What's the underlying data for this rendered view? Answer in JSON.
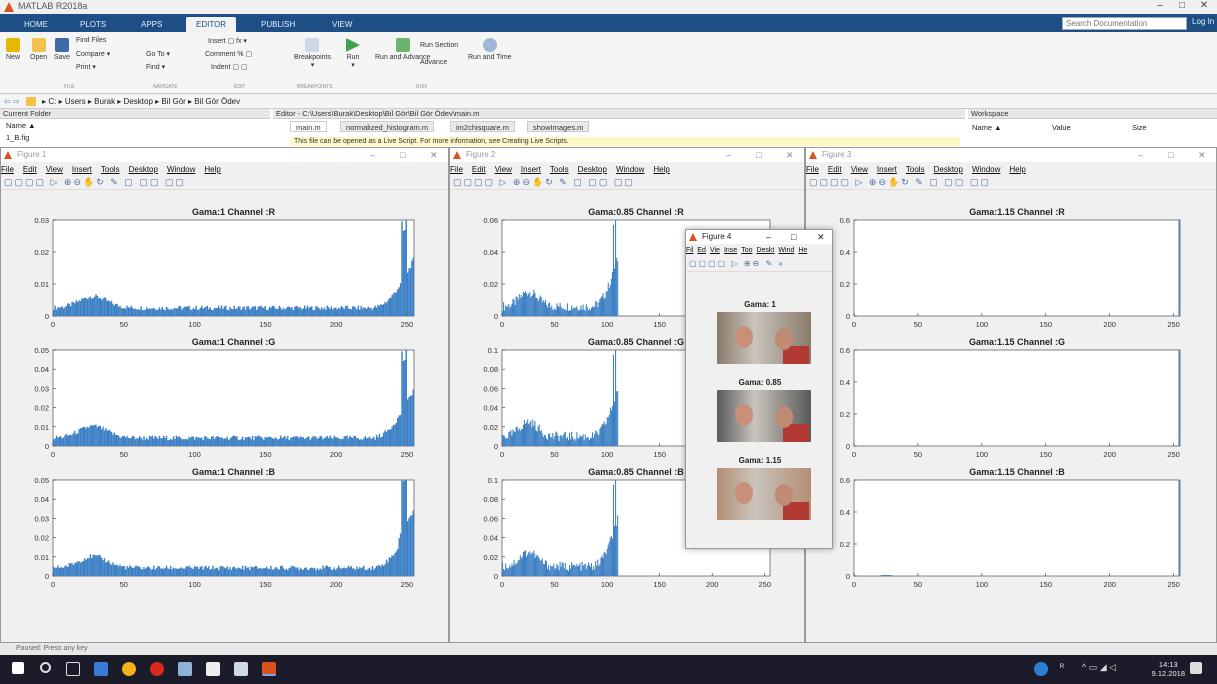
{
  "app": {
    "title": "MATLAB R2018a"
  },
  "tabs": [
    "HOME",
    "PLOTS",
    "APPS",
    "EDITOR",
    "PUBLISH",
    "VIEW"
  ],
  "search_placeholder": "Search Documentation",
  "login": "Log In",
  "toolstrip": {
    "new": "New",
    "open": "Open",
    "save": "Save",
    "find_files": "Find Files",
    "compare": "Compare",
    "print": "Print",
    "go_to": "Go To",
    "find": "Find",
    "insert": "Insert",
    "comment": "Comment",
    "indent": "Indent",
    "breakpoints": "Breakpoints",
    "run": "Run",
    "run_and_advance": "Run and Advance",
    "run_section": "Run Section",
    "advance": "Advance",
    "run_and_time": "Run and Time",
    "groups": [
      "FILE",
      "NAVIGATE",
      "EDIT",
      "BREAKPOINTS",
      "RUN"
    ]
  },
  "address": [
    "C:",
    "Users",
    "Burak",
    "Desktop",
    "Bil Gör",
    "Bil Gör Ödev"
  ],
  "current_folder": {
    "title": "Current Folder",
    "col": "Name ▲",
    "file": "1_B.fig"
  },
  "editor": {
    "title": "Editor - C:\\Users\\Burak\\Desktop\\Bil Gör\\Bil Gör Ödev\\main.m",
    "tabs": [
      "main.m",
      "normalized_histogram.m",
      "im2chisquare.m",
      "showImages.m"
    ],
    "info": "This file can be opened as a Live Script. For more information, see Creating Live Scripts."
  },
  "workspace": {
    "title": "Workspace",
    "cols": [
      "Name ▲",
      "Value",
      "Size"
    ]
  },
  "status_text": "Paused: Press any key",
  "fig_menu": [
    "File",
    "Edit",
    "View",
    "Insert",
    "Tools",
    "Desktop",
    "Window",
    "Help"
  ],
  "figures": [
    {
      "title": "Figure 1",
      "plots": [
        {
          "title": "Gama:1 Channel :R",
          "yticks": [
            "0",
            "0.01",
            "0.02",
            "0.03"
          ],
          "peak": 0.03
        },
        {
          "title": "Gama:1 Channel :G",
          "yticks": [
            "0",
            "0.01",
            "0.02",
            "0.03",
            "0.04",
            "0.05"
          ],
          "peak": 0.05
        },
        {
          "title": "Gama:1 Channel :B",
          "yticks": [
            "0",
            "0.01",
            "0.02",
            "0.03",
            "0.04",
            "0.05"
          ],
          "peak": 0.05
        }
      ]
    },
    {
      "title": "Figure 2",
      "plots": [
        {
          "title": "Gama:0.85 Channel :R",
          "yticks": [
            "0",
            "0.02",
            "0.04",
            "0.06"
          ],
          "peak": 0.06
        },
        {
          "title": "Gama:0.85 Channel :G",
          "yticks": [
            "0",
            "0.02",
            "0.04",
            "0.06",
            "0.08",
            "0.1"
          ],
          "peak": 0.1
        },
        {
          "title": "Gama:0.85 Channel :B",
          "yticks": [
            "0",
            "0.02",
            "0.04",
            "0.06",
            "0.08",
            "0.1"
          ],
          "peak": 0.1
        }
      ]
    },
    {
      "title": "Figure 3",
      "plots": [
        {
          "title": "Gama:1.15 Channel :R",
          "yticks": [
            "0",
            "0.2",
            "0.4",
            "0.6"
          ],
          "peak": 0.6
        },
        {
          "title": "Gama:1.15 Channel :G",
          "yticks": [
            "0",
            "0.2",
            "0.4",
            "0.6"
          ],
          "peak": 0.6
        },
        {
          "title": "Gama:1.15 Channel :B",
          "yticks": [
            "0",
            "0.2",
            "0.4",
            "0.6"
          ],
          "peak": 0.6
        }
      ]
    }
  ],
  "xticks": [
    "0",
    "50",
    "100",
    "150",
    "200",
    "250"
  ],
  "figure4": {
    "title": "Figure 4",
    "menu": [
      "Fil",
      "Ed",
      "Vie",
      "Inse",
      "Too",
      "Deskt",
      "Wind",
      "He"
    ],
    "images": [
      "Gama: 1",
      "Gama: 0.85",
      "Gama: 1.15"
    ]
  },
  "taskbar": {
    "time": "14:13",
    "date": "9.12.2018"
  },
  "colors": {
    "bar": "#3b7fc4",
    "accent": "#1d4f86"
  },
  "chart_data": [
    {
      "type": "bar",
      "title": "Gama:1 Channel :R",
      "ylim": [
        0,
        0.03
      ],
      "xlim": [
        0,
        255
      ]
    },
    {
      "type": "bar",
      "title": "Gama:1 Channel :G",
      "ylim": [
        0,
        0.05
      ],
      "xlim": [
        0,
        255
      ]
    },
    {
      "type": "bar",
      "title": "Gama:1 Channel :B",
      "ylim": [
        0,
        0.05
      ],
      "xlim": [
        0,
        255
      ]
    },
    {
      "type": "bar",
      "title": "Gama:0.85 Channel :R",
      "ylim": [
        0,
        0.06
      ],
      "xlim": [
        0,
        255
      ]
    },
    {
      "type": "bar",
      "title": "Gama:0.85 Channel :G",
      "ylim": [
        0,
        0.1
      ],
      "xlim": [
        0,
        255
      ]
    },
    {
      "type": "bar",
      "title": "Gama:0.85 Channel :B",
      "ylim": [
        0,
        0.1
      ],
      "xlim": [
        0,
        255
      ]
    },
    {
      "type": "bar",
      "title": "Gama:1.15 Channel :R",
      "ylim": [
        0,
        0.6
      ],
      "xlim": [
        0,
        255
      ]
    },
    {
      "type": "bar",
      "title": "Gama:1.15 Channel :G",
      "ylim": [
        0,
        0.6
      ],
      "xlim": [
        0,
        255
      ]
    },
    {
      "type": "bar",
      "title": "Gama:1.15 Channel :B",
      "ylim": [
        0,
        0.6
      ],
      "xlim": [
        0,
        255
      ]
    }
  ]
}
